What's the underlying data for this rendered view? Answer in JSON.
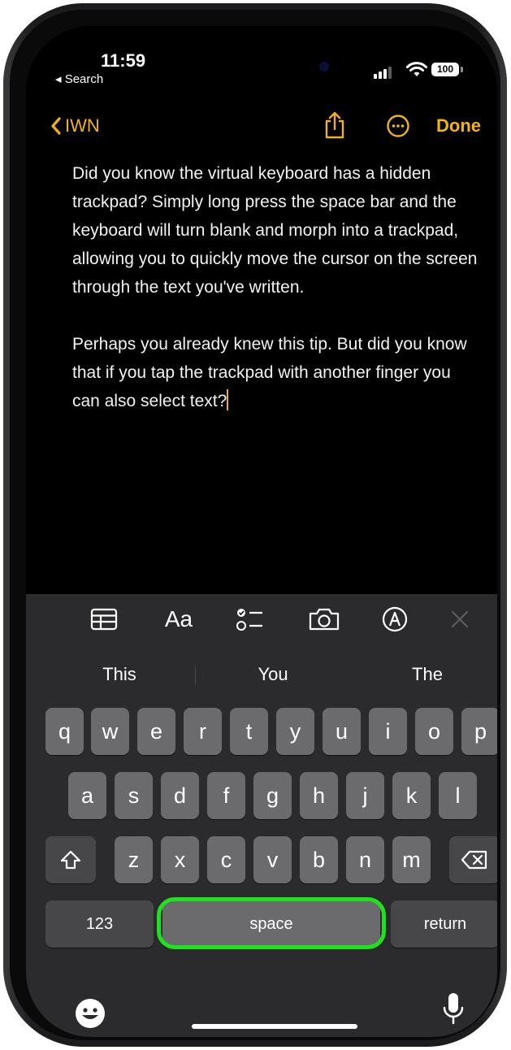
{
  "status_bar": {
    "time": "11:59",
    "back_app": "◂ Search",
    "battery": "100"
  },
  "nav": {
    "back_label": "IWN",
    "done_label": "Done",
    "accent_color": "#f3b21a"
  },
  "note": {
    "paragraph1": "Did you know the virtual keyboard has a hidden trackpad? Simply long press the space bar and the keyboard will turn blank and morph into a trackpad, allowing you to quickly move the cursor on the screen through the text you've written.",
    "paragraph2": "Perhaps you already knew this tip. But did you know that if you tap the trackpad with another finger you can also select text?"
  },
  "toolbar": {
    "format_label": "Aa",
    "icons": [
      "table-icon",
      "format-icon",
      "checklist-icon",
      "camera-icon",
      "markup-icon",
      "close-icon"
    ]
  },
  "suggestions": [
    "This",
    "You",
    "The"
  ],
  "keyboard": {
    "row1": [
      "q",
      "w",
      "e",
      "r",
      "t",
      "y",
      "u",
      "i",
      "o",
      "p"
    ],
    "row2": [
      "a",
      "s",
      "d",
      "f",
      "g",
      "h",
      "j",
      "k",
      "l"
    ],
    "row3": [
      "z",
      "x",
      "c",
      "v",
      "b",
      "n",
      "m"
    ],
    "numbers_label": "123",
    "space_label": "space",
    "return_label": "return",
    "highlight_color": "#1de21d"
  }
}
